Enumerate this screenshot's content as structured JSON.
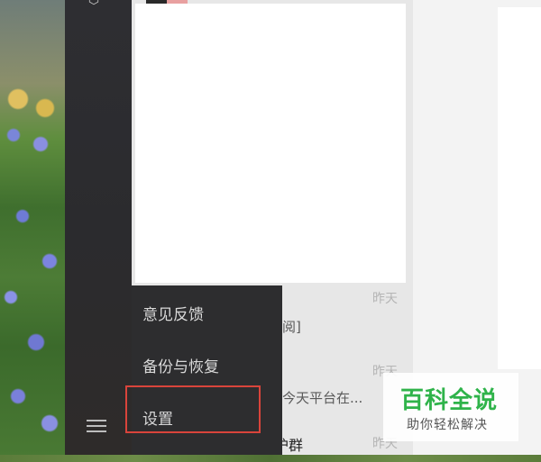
{
  "menu": {
    "items": [
      {
        "label": "意见反馈"
      },
      {
        "label": "备份与恢复"
      },
      {
        "label": "设置"
      }
    ]
  },
  "chat_list": {
    "times": [
      "昨天",
      "昨天",
      "昨天"
    ],
    "snippets": [
      "阅]",
      "今天平台在..."
    ],
    "group_name": "三期锅炉维护群"
  },
  "watermark": {
    "title": "百科全说",
    "subtitle": "助你轻松解决"
  },
  "icons": {
    "rail_top": "cube-icon",
    "menu_toggle": "hamburger-menu-icon"
  },
  "colors": {
    "highlight": "#d9443b",
    "watermark_green": "#2fb34a",
    "menu_bg": "#2d2d2f"
  }
}
